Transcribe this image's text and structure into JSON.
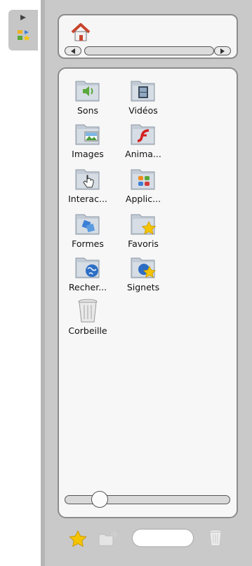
{
  "items": [
    {
      "label": "Sons",
      "icon": "folder-sound-icon"
    },
    {
      "label": "Vidéos",
      "icon": "folder-video-icon"
    },
    {
      "label": "Images",
      "icon": "folder-images-icon"
    },
    {
      "label": "Anima...",
      "icon": "folder-flash-icon"
    },
    {
      "label": "Interac...",
      "icon": "folder-interactive-icon"
    },
    {
      "label": "Applic...",
      "icon": "folder-applications-icon"
    },
    {
      "label": "Formes",
      "icon": "folder-shapes-icon"
    },
    {
      "label": "Favoris",
      "icon": "folder-favorites-icon"
    },
    {
      "label": "Recher...",
      "icon": "folder-search-icon"
    },
    {
      "label": "Signets",
      "icon": "folder-bookmarks-icon"
    },
    {
      "label": "Corbeille",
      "icon": "trash-icon"
    }
  ],
  "zoom_slider": {
    "value": 0.15
  },
  "search": {
    "value": ""
  },
  "colors": {
    "folder": "#c3ccd6",
    "star": "#f5c400",
    "home_roof": "#c8452d"
  }
}
